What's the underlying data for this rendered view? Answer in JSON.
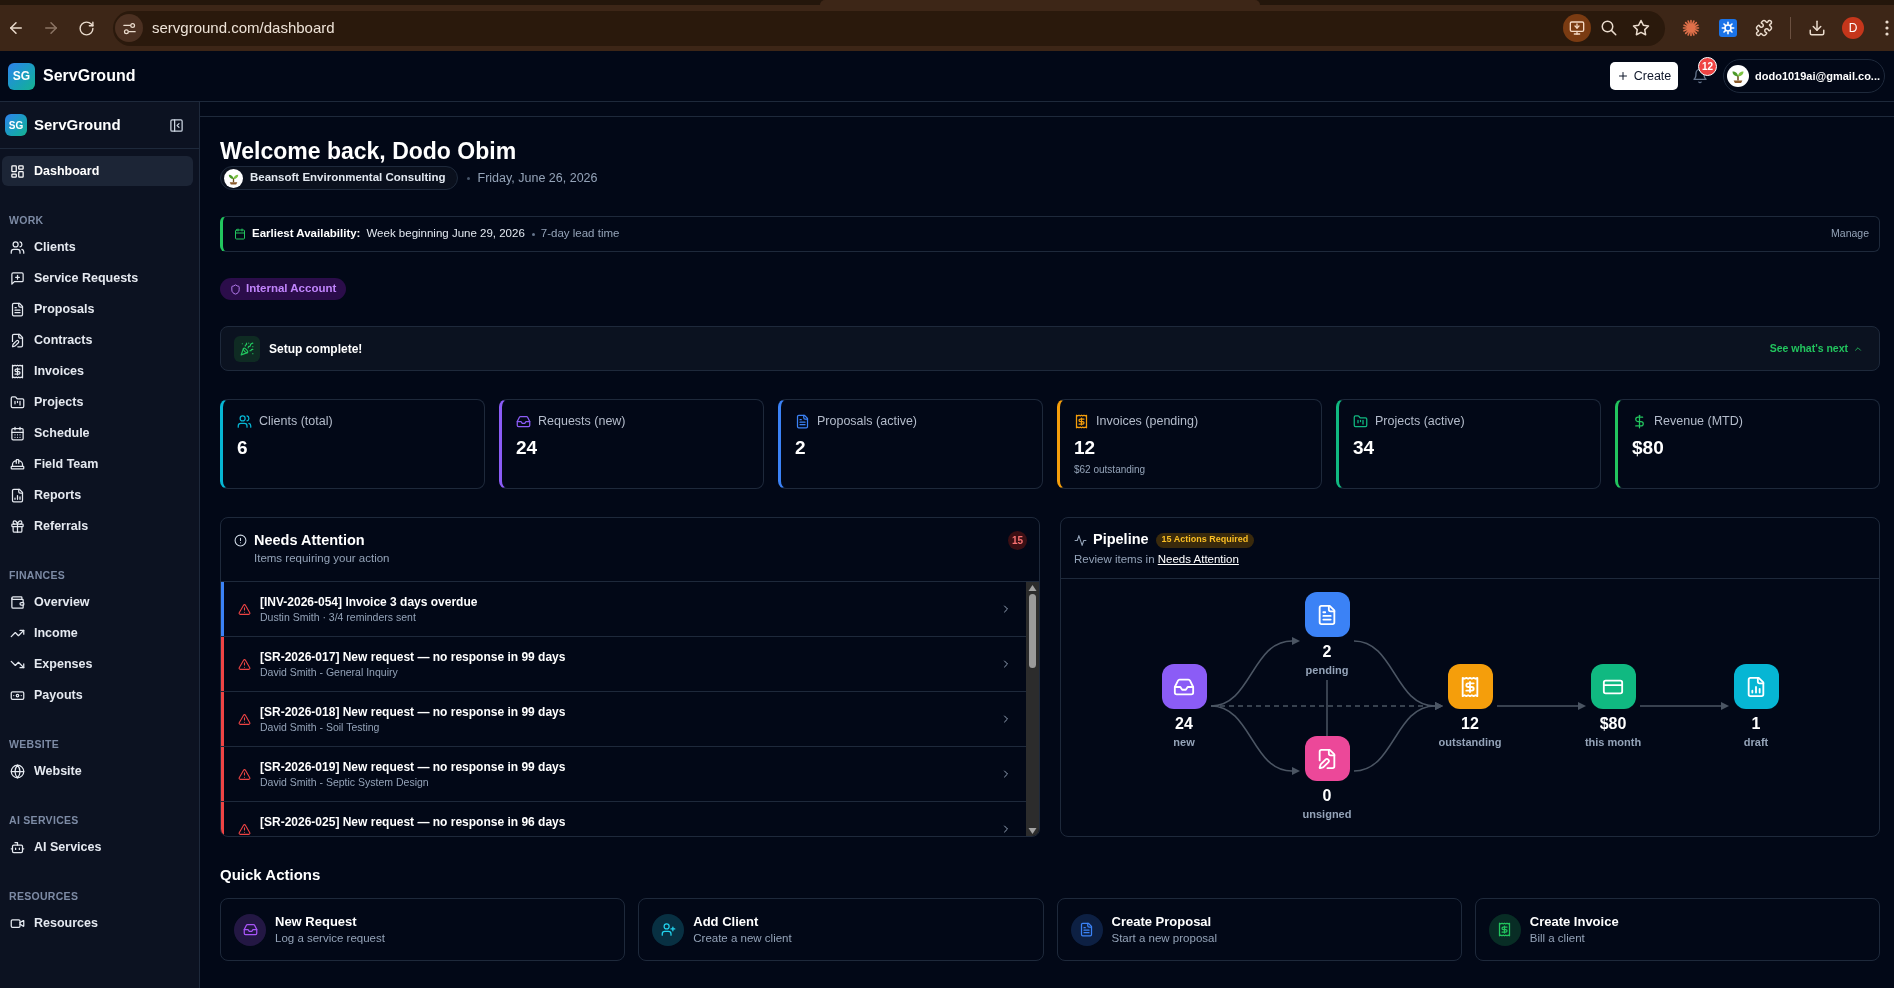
{
  "browser": {
    "url": "servground.com/dashboard",
    "profile_initial": "D"
  },
  "header": {
    "logo_text": "SG",
    "brand": "ServGround",
    "create_label": "Create",
    "notification_count": "12",
    "user_email": "dodo1019ai@gmail.co..."
  },
  "sidebar": {
    "logo_text": "SG",
    "brand": "ServGround",
    "sections": [
      {
        "items": [
          {
            "label": "Dashboard",
            "selected": true
          }
        ]
      },
      {
        "heading": "WORK",
        "items": [
          {
            "label": "Clients",
            "selected": false
          },
          {
            "label": "Service Requests",
            "selected": false
          },
          {
            "label": "Proposals",
            "selected": false
          },
          {
            "label": "Contracts",
            "selected": false
          },
          {
            "label": "Invoices",
            "selected": false
          },
          {
            "label": "Projects",
            "selected": false
          },
          {
            "label": "Schedule",
            "selected": false
          },
          {
            "label": "Field Team",
            "selected": false
          },
          {
            "label": "Reports",
            "selected": false
          },
          {
            "label": "Referrals",
            "selected": false
          }
        ]
      },
      {
        "heading": "FINANCES",
        "items": [
          {
            "label": "Overview",
            "selected": false
          },
          {
            "label": "Income",
            "selected": false
          },
          {
            "label": "Expenses",
            "selected": false
          },
          {
            "label": "Payouts",
            "selected": false
          }
        ]
      },
      {
        "heading": "WEBSITE",
        "items": [
          {
            "label": "Website",
            "selected": false
          }
        ]
      },
      {
        "heading": "AI SERVICES",
        "items": [
          {
            "label": "AI Services",
            "selected": false
          }
        ]
      },
      {
        "heading": "RESOURCES",
        "items": [
          {
            "label": "Resources",
            "selected": false
          }
        ]
      }
    ]
  },
  "welcome": {
    "title": "Welcome back, Dodo Obim",
    "company": "Beansoft Environmental Consulting",
    "date": "Friday, June 26, 2026"
  },
  "availability": {
    "label": "Earliest Availability:",
    "value": "Week beginning June 29, 2026",
    "lead_time": "7-day lead time",
    "action": "Manage"
  },
  "account_tag": "Internal Account",
  "setup_banner": {
    "title": "Setup complete!",
    "action": "See what's next"
  },
  "stats": [
    {
      "label": "Clients (total)",
      "value": "6",
      "color": "#06b6d4"
    },
    {
      "label": "Requests (new)",
      "value": "24",
      "color": "#8b5cf6"
    },
    {
      "label": "Proposals (active)",
      "value": "2",
      "color": "#3b82f6"
    },
    {
      "label": "Invoices (pending)",
      "value": "12",
      "note": "$62 outstanding",
      "color": "#f59e0b"
    },
    {
      "label": "Projects (active)",
      "value": "34",
      "color": "#10b981"
    },
    {
      "label": "Revenue (MTD)",
      "value": "$80",
      "color": "#22c55e"
    }
  ],
  "needs_attention": {
    "title": "Needs Attention",
    "subtitle": "Items requiring your action",
    "count": "15",
    "items": [
      {
        "title": "[INV-2026-054] Invoice 3 days overdue",
        "detail": "Dustin Smith · 3/4 reminders sent",
        "color": "#3b82f6"
      },
      {
        "title": "[SR-2026-017] New request — no response in 99 days",
        "detail": "David Smith - General Inquiry",
        "color": "#ef4444"
      },
      {
        "title": "[SR-2026-018] New request — no response in 99 days",
        "detail": "David Smith - Soil Testing",
        "color": "#ef4444"
      },
      {
        "title": "[SR-2026-019] New request — no response in 99 days",
        "detail": "David Smith - Septic System Design",
        "color": "#ef4444"
      },
      {
        "title": "[SR-2026-025] New request — no response in 96 days",
        "color": "#ef4444"
      }
    ]
  },
  "pipeline": {
    "title": "Pipeline",
    "badge": "15 Actions Required",
    "subtitle": "Review items in ",
    "link": "Needs Attention",
    "columns": [
      {
        "nodes": [
          {
            "value": "24",
            "label": "new",
            "color": "#8b5cf6"
          }
        ]
      },
      {
        "nodes": [
          {
            "value": "2",
            "label": "pending",
            "color": "#3b82f6"
          },
          {
            "value": "0",
            "label": "unsigned",
            "color": "#ec4899"
          }
        ]
      },
      {
        "nodes": [
          {
            "value": "12",
            "label": "outstanding",
            "color": "#f59e0b"
          }
        ]
      },
      {
        "nodes": [
          {
            "value": "$80",
            "label": "this month",
            "color": "#10b981"
          }
        ]
      },
      {
        "nodes": [
          {
            "value": "1",
            "label": "draft",
            "color": "#06b6d4"
          }
        ]
      }
    ]
  },
  "quick_actions": {
    "title": "Quick Actions",
    "items": [
      {
        "title": "New Request",
        "subtitle": "Log a service request",
        "color": "#a855f7"
      },
      {
        "title": "Add Client",
        "subtitle": "Create a new client",
        "color": "#22d3ee"
      },
      {
        "title": "Create Proposal",
        "subtitle": "Start a new proposal",
        "color": "#3b82f6"
      },
      {
        "title": "Create Invoice",
        "subtitle": "Bill a client",
        "color": "#22c55e"
      }
    ]
  }
}
